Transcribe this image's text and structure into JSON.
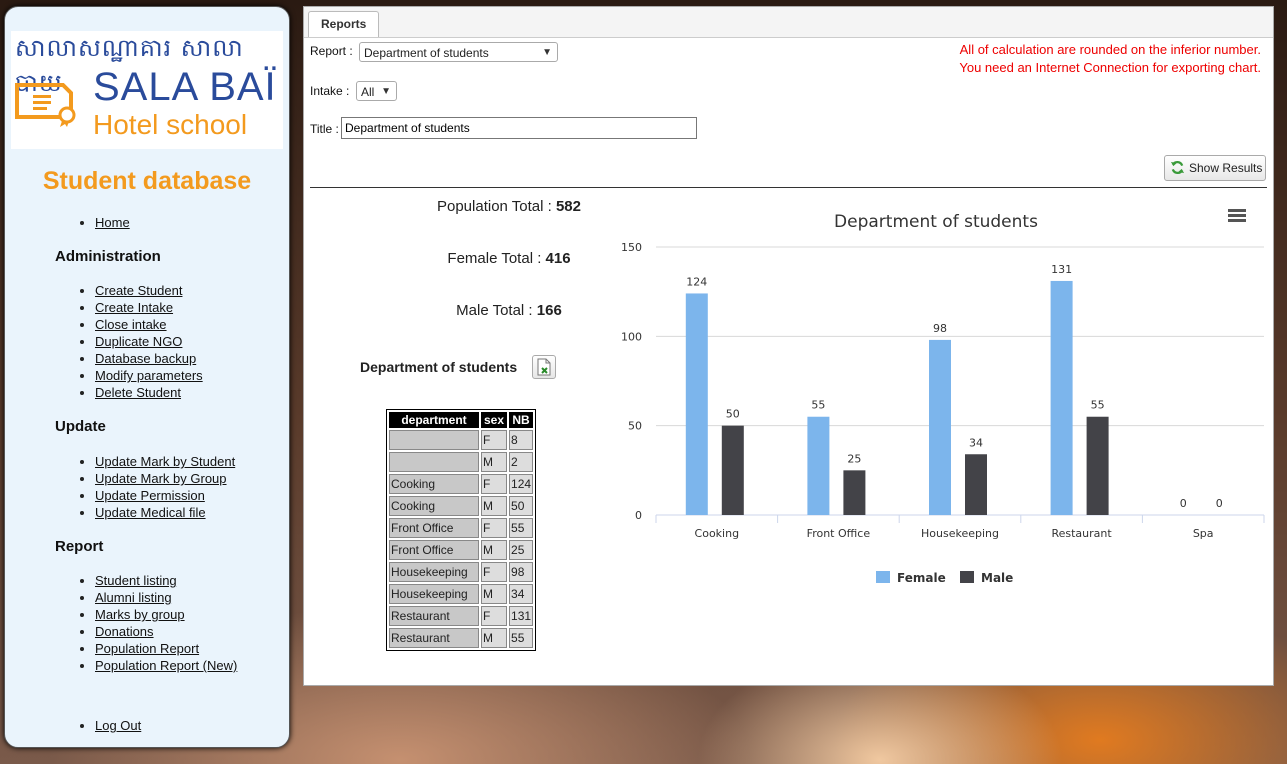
{
  "sidebar": {
    "logo": {
      "khmer": "សាលាសណ្ឋាគារ សាលាបាយ",
      "sala": "SALA BAÏ",
      "hotel": "Hotel",
      "school": "school"
    },
    "title": "Student database",
    "home": "Home",
    "administration": {
      "heading": "Administration",
      "items": [
        "Create Student",
        "Create Intake",
        "Close intake",
        "Duplicate NGO",
        "Database backup",
        "Modify parameters",
        "Delete Student"
      ]
    },
    "update": {
      "heading": "Update",
      "items": [
        "Update Mark by Student",
        "Update Mark by Group",
        "Update Permission",
        "Update Medical file"
      ]
    },
    "report": {
      "heading": "Report",
      "items": [
        "Student listing",
        "Alumni listing",
        "Marks by group",
        "Donations",
        "Population Report",
        "Population Report (New)"
      ]
    },
    "logout": "Log Out"
  },
  "main": {
    "tab": "Reports",
    "report_label": "Report :",
    "report_value": "Department of students",
    "intake_label": "Intake :",
    "intake_value": "All",
    "title_label": "Title :",
    "title_value": "Department of students",
    "note1": "All of calculation are rounded on the inferior number.",
    "note2": "You need an Internet Connection for exporting chart.",
    "show_results": "Show Results",
    "population_label": "Population Total : ",
    "population_value": "582",
    "female_label": "Female Total : ",
    "female_value": "416",
    "male_label": "Male Total : ",
    "male_value": "166",
    "dept_title": "Department of students",
    "table": {
      "headers": [
        "department",
        "sex",
        "NB"
      ],
      "rows": [
        [
          "",
          "F",
          "8"
        ],
        [
          "",
          "M",
          "2"
        ],
        [
          "Cooking",
          "F",
          "124"
        ],
        [
          "Cooking",
          "M",
          "50"
        ],
        [
          "Front Office",
          "F",
          "55"
        ],
        [
          "Front Office",
          "M",
          "25"
        ],
        [
          "Housekeeping",
          "F",
          "98"
        ],
        [
          "Housekeeping",
          "M",
          "34"
        ],
        [
          "Restaurant",
          "F",
          "131"
        ],
        [
          "Restaurant",
          "M",
          "55"
        ]
      ]
    }
  },
  "chart_data": {
    "type": "bar",
    "title": "Department of students",
    "categories": [
      "Cooking",
      "Front Office",
      "Housekeeping",
      "Restaurant",
      "Spa"
    ],
    "series": [
      {
        "name": "Female",
        "values": [
          124,
          55,
          98,
          131,
          0
        ],
        "color": "#7cb5ec"
      },
      {
        "name": "Male",
        "values": [
          50,
          25,
          34,
          55,
          0
        ],
        "color": "#434348"
      }
    ],
    "yticks": [
      0,
      50,
      100,
      150
    ],
    "ylim": [
      0,
      150
    ],
    "legend": "bottom-center",
    "grid": true
  }
}
